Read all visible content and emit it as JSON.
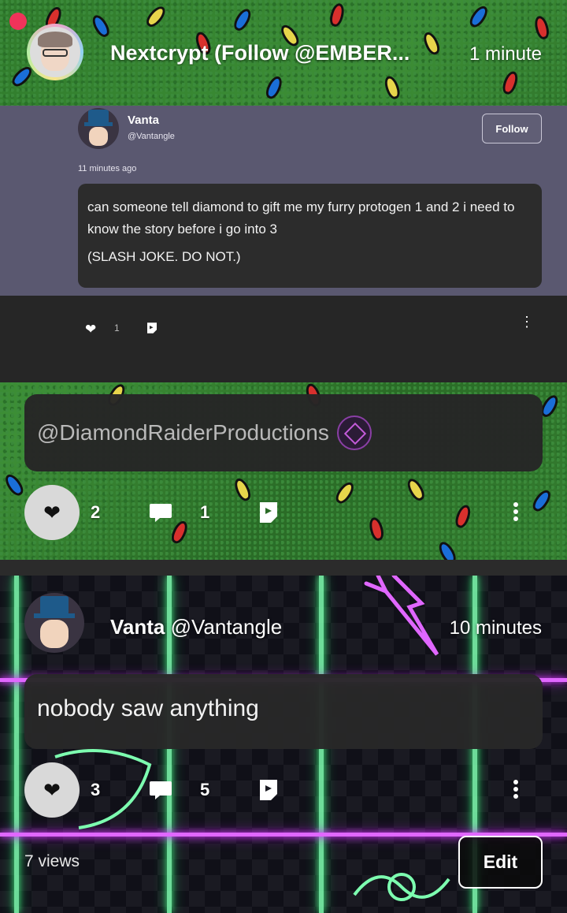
{
  "post1": {
    "author_line": "Nextcrypt (Follow @EMBER...",
    "time": "1 minute",
    "embed": {
      "name": "Vanta",
      "handle": "@Vantangle",
      "follow_label": "Follow",
      "ago": "11 minutes ago",
      "text_line1": "can someone tell diamond to gift me my furry protogen 1 and 2 i need to know the story before i go into 3",
      "text_line2": "(SLASH JOKE. DO NOT.)",
      "like_count": "1"
    },
    "mention": "@DiamondRaiderProductions",
    "likes": "2",
    "comments": "1"
  },
  "post2": {
    "name": "Vanta",
    "handle": "@Vantangle",
    "time": "10 minutes",
    "text": "nobody saw anything",
    "likes": "3",
    "comments": "5",
    "views": "7 views",
    "edit_label": "Edit"
  },
  "icons": {
    "like": "heart-icon",
    "comment": "comment-icon",
    "share": "share-icon",
    "more": "more-vertical-icon"
  },
  "colors": {
    "record_dot": "#f0335a",
    "embed_bg": "#5a5870",
    "bubble_bg": "#2c2c2c",
    "neon_green": "#7dffb0",
    "neon_purple": "#e067ff"
  }
}
